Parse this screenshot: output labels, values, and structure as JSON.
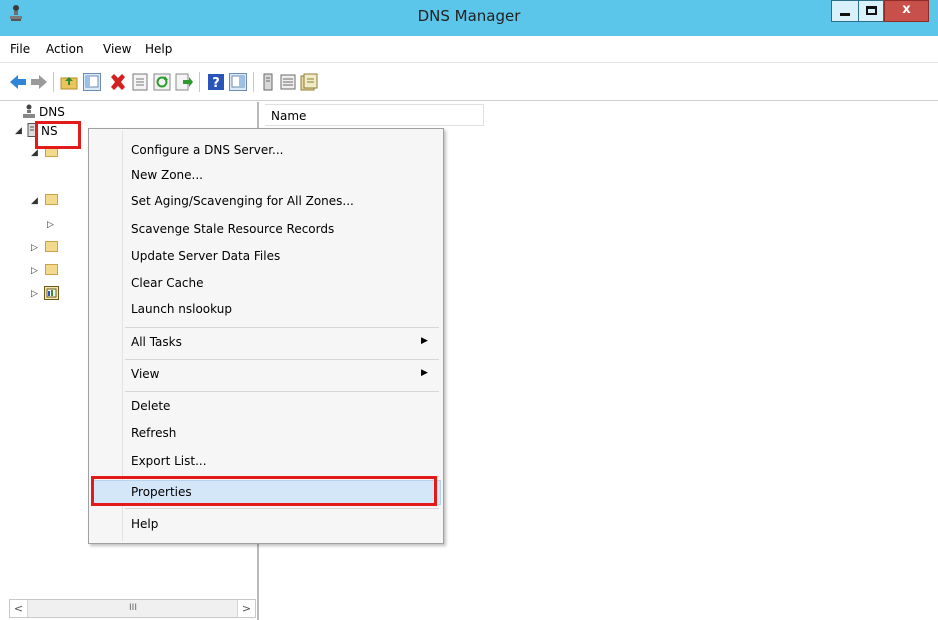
{
  "window": {
    "title": "DNS Manager",
    "close_glyph": "x",
    "minimize_icon": "minimize-icon",
    "maximize_icon": "maximize-icon"
  },
  "menubar": {
    "items": [
      "File",
      "Action",
      "View",
      "Help"
    ]
  },
  "toolbar": {
    "icons": [
      "back-arrow-icon",
      "forward-arrow-icon",
      "up-folder-icon",
      "show-hide-console-tree-icon",
      "delete-icon",
      "properties-icon",
      "refresh-icon",
      "export-list-icon",
      "help-icon",
      "show-hide-action-pane-icon",
      "server-icon",
      "zone-icon",
      "new-record-icon"
    ]
  },
  "tree": {
    "root_label": "DNS",
    "server_label": "NS",
    "nodes_icons": [
      "folder-icon",
      "folder-icon",
      "folder-icon",
      "folder-icon",
      "global-logs-icon"
    ]
  },
  "list": {
    "columns": [
      "Name"
    ]
  },
  "scrollbar": {
    "left_arrow": "<",
    "right_arrow": ">",
    "thumb_grip": "III"
  },
  "context_menu": {
    "items": [
      {
        "label": "Configure a DNS Server..."
      },
      {
        "label": "New Zone..."
      },
      {
        "label": "Set Aging/Scavenging for All Zones..."
      },
      {
        "label": "Scavenge Stale Resource Records"
      },
      {
        "label": "Update Server Data Files"
      },
      {
        "label": "Clear Cache"
      },
      {
        "label": "Launch nslookup"
      },
      {
        "label": "All Tasks",
        "submenu": true
      },
      {
        "label": "View",
        "submenu": true
      },
      {
        "label": "Delete"
      },
      {
        "label": "Refresh"
      },
      {
        "label": "Export List..."
      },
      {
        "label": "Properties",
        "selected": true
      },
      {
        "label": "Help"
      }
    ],
    "submenu_arrow": "▶"
  },
  "colors": {
    "titlebar": "#5bc5ea",
    "highlight_box": "#e31a1a",
    "selected_item": "#d3e7f8",
    "close_button": "#c7504b"
  }
}
